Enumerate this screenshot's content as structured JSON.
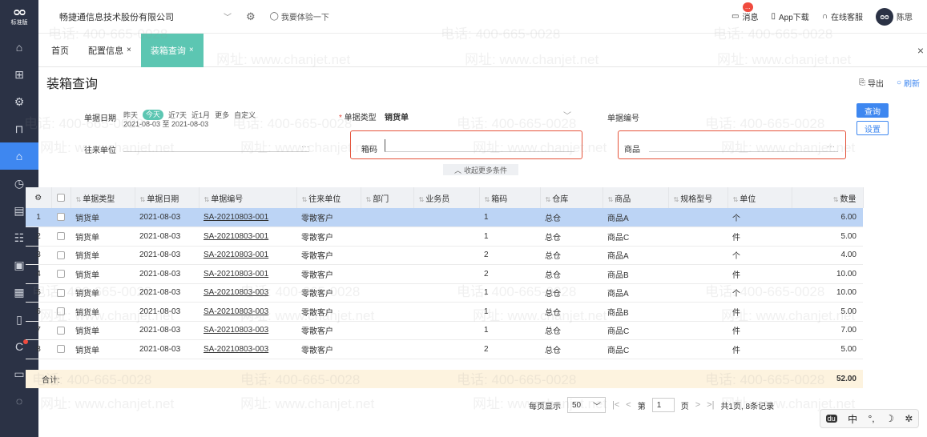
{
  "rail": {
    "edition": "标准版",
    "items": [
      {
        "icon": "home-icon",
        "glyph": "⌂"
      },
      {
        "icon": "gift-icon",
        "glyph": "⊞"
      },
      {
        "icon": "settings-icon",
        "glyph": "⚙"
      },
      {
        "icon": "bag-icon",
        "glyph": "⊓"
      },
      {
        "icon": "warehouse-icon",
        "glyph": "⌂",
        "active": true
      },
      {
        "icon": "timer-icon",
        "glyph": "◷"
      },
      {
        "icon": "report-icon",
        "glyph": "▤"
      },
      {
        "icon": "people-icon",
        "glyph": "☷"
      },
      {
        "icon": "ledger-icon",
        "glyph": "▣"
      },
      {
        "icon": "chart-icon",
        "glyph": "▦"
      },
      {
        "icon": "doc-icon",
        "glyph": "▯"
      },
      {
        "icon": "brand-icon",
        "glyph": "C",
        "dot": true
      },
      {
        "icon": "invoice-icon",
        "glyph": "▭"
      },
      {
        "icon": "more-icon",
        "glyph": "◌"
      }
    ]
  },
  "header": {
    "company": "畅捷通信息技术股份有限公司",
    "try_label": "我要体验一下",
    "messages_label": "消息",
    "messages_badge": "...",
    "app_label": "App下载",
    "service_label": "在线客服",
    "avatar_text": "ᴑᴑ",
    "user_name": "陈思"
  },
  "tabs": [
    {
      "label": "首页",
      "closable": false,
      "active": false
    },
    {
      "label": "配置信息",
      "closable": true,
      "active": false
    },
    {
      "label": "装箱查询",
      "closable": true,
      "active": true
    }
  ],
  "page": {
    "title": "装箱查询",
    "export_label": "导出",
    "refresh_label": "刷新"
  },
  "filters": {
    "date_label": "单据日期",
    "date_options": [
      "昨天",
      "今天",
      "近7天",
      "近1月",
      "更多",
      "自定义"
    ],
    "date_range": "2021-08-03 至 2021-08-03",
    "doc_type_label": "单据类型",
    "doc_type_value": "销货单",
    "doc_no_label": "单据编号",
    "partner_label": "往来单位",
    "box_label": "箱码",
    "box_value": "",
    "product_label": "商品",
    "query_button": "查询",
    "settings_button": "设置",
    "collapse_label": "收起更多条件"
  },
  "table": {
    "columns": [
      "",
      "",
      "单据类型",
      "单据日期",
      "单据编号",
      "往来单位",
      "部门",
      "业务员",
      "箱码",
      "仓库",
      "商品",
      "规格型号",
      "单位",
      "数量"
    ],
    "rows": [
      [
        "1",
        "销货单",
        "2021-08-03",
        "SA-20210803-001",
        "零散客户",
        "",
        "",
        "1",
        "总仓",
        "商品A",
        "",
        "个",
        "6.00"
      ],
      [
        "2",
        "销货单",
        "2021-08-03",
        "SA-20210803-001",
        "零散客户",
        "",
        "",
        "1",
        "总仓",
        "商品C",
        "",
        "件",
        "5.00"
      ],
      [
        "3",
        "销货单",
        "2021-08-03",
        "SA-20210803-001",
        "零散客户",
        "",
        "",
        "2",
        "总仓",
        "商品A",
        "",
        "个",
        "4.00"
      ],
      [
        "4",
        "销货单",
        "2021-08-03",
        "SA-20210803-001",
        "零散客户",
        "",
        "",
        "2",
        "总仓",
        "商品B",
        "",
        "件",
        "10.00"
      ],
      [
        "5",
        "销货单",
        "2021-08-03",
        "SA-20210803-003",
        "零散客户",
        "",
        "",
        "1",
        "总仓",
        "商品A",
        "",
        "个",
        "10.00"
      ],
      [
        "6",
        "销货单",
        "2021-08-03",
        "SA-20210803-003",
        "零散客户",
        "",
        "",
        "1",
        "总仓",
        "商品B",
        "",
        "件",
        "5.00"
      ],
      [
        "7",
        "销货单",
        "2021-08-03",
        "SA-20210803-003",
        "零散客户",
        "",
        "",
        "1",
        "总仓",
        "商品C",
        "",
        "件",
        "7.00"
      ],
      [
        "8",
        "销货单",
        "2021-08-03",
        "SA-20210803-003",
        "零散客户",
        "",
        "",
        "2",
        "总仓",
        "商品C",
        "",
        "件",
        "5.00"
      ]
    ],
    "selected_row": 0,
    "total_label": "合计:",
    "total_value": "52.00"
  },
  "pager": {
    "per_page_label": "每页显示",
    "per_page_value": "50",
    "page_prefix": "第",
    "page_value": "1",
    "page_suffix": "页",
    "summary": "共1页, 8条记录"
  },
  "ime": {
    "items": [
      "du",
      "中",
      "°,",
      "☽",
      "✲"
    ]
  },
  "watermark": {
    "phone": "电话: 400-665-0028",
    "site": "网址: www.chanjet.net"
  }
}
